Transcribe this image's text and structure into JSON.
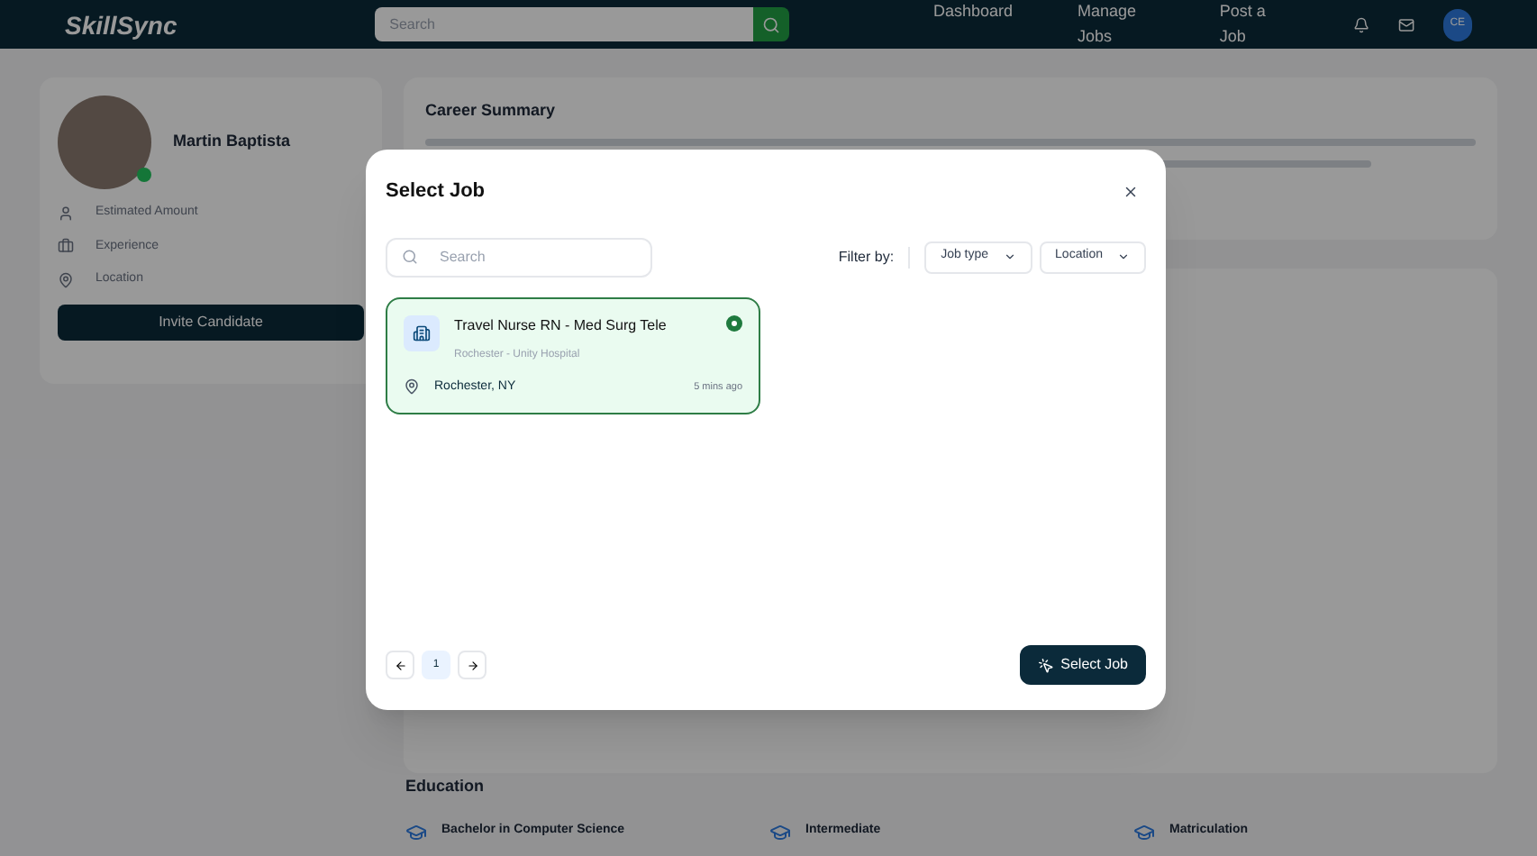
{
  "header": {
    "logo": "SkillSync",
    "search": {
      "placeholder": "Search"
    },
    "nav": [
      "Dashboard",
      "Manage Jobs",
      "Post a Job"
    ],
    "avatar": "CE"
  },
  "profile": {
    "name": "Martin Baptista",
    "online": true,
    "details": [
      {
        "label": "Estimated Amount"
      },
      {
        "label": "Experience"
      },
      {
        "label": "Location"
      }
    ],
    "invite_button": "Invite Candidate"
  },
  "career_summary": {
    "title": "Career Summary"
  },
  "education": {
    "title": "Education",
    "items": [
      "Bachelor in Computer Science",
      "Intermediate",
      "Matriculation"
    ]
  },
  "modal": {
    "title": "Select Job",
    "search": {
      "placeholder": "Search"
    },
    "filter_label": "Filter by:",
    "filters": [
      "Job type",
      "Location"
    ],
    "jobs": [
      {
        "title": "Travel Nurse RN - Med Surg Tele",
        "subtitle": "Rochester - Unity Hospital",
        "location": "Rochester, NY",
        "time": "5 mins ago",
        "selected": true
      }
    ],
    "pages": [
      {
        "label": "1",
        "selected": true
      }
    ],
    "submit": "Select Job"
  }
}
